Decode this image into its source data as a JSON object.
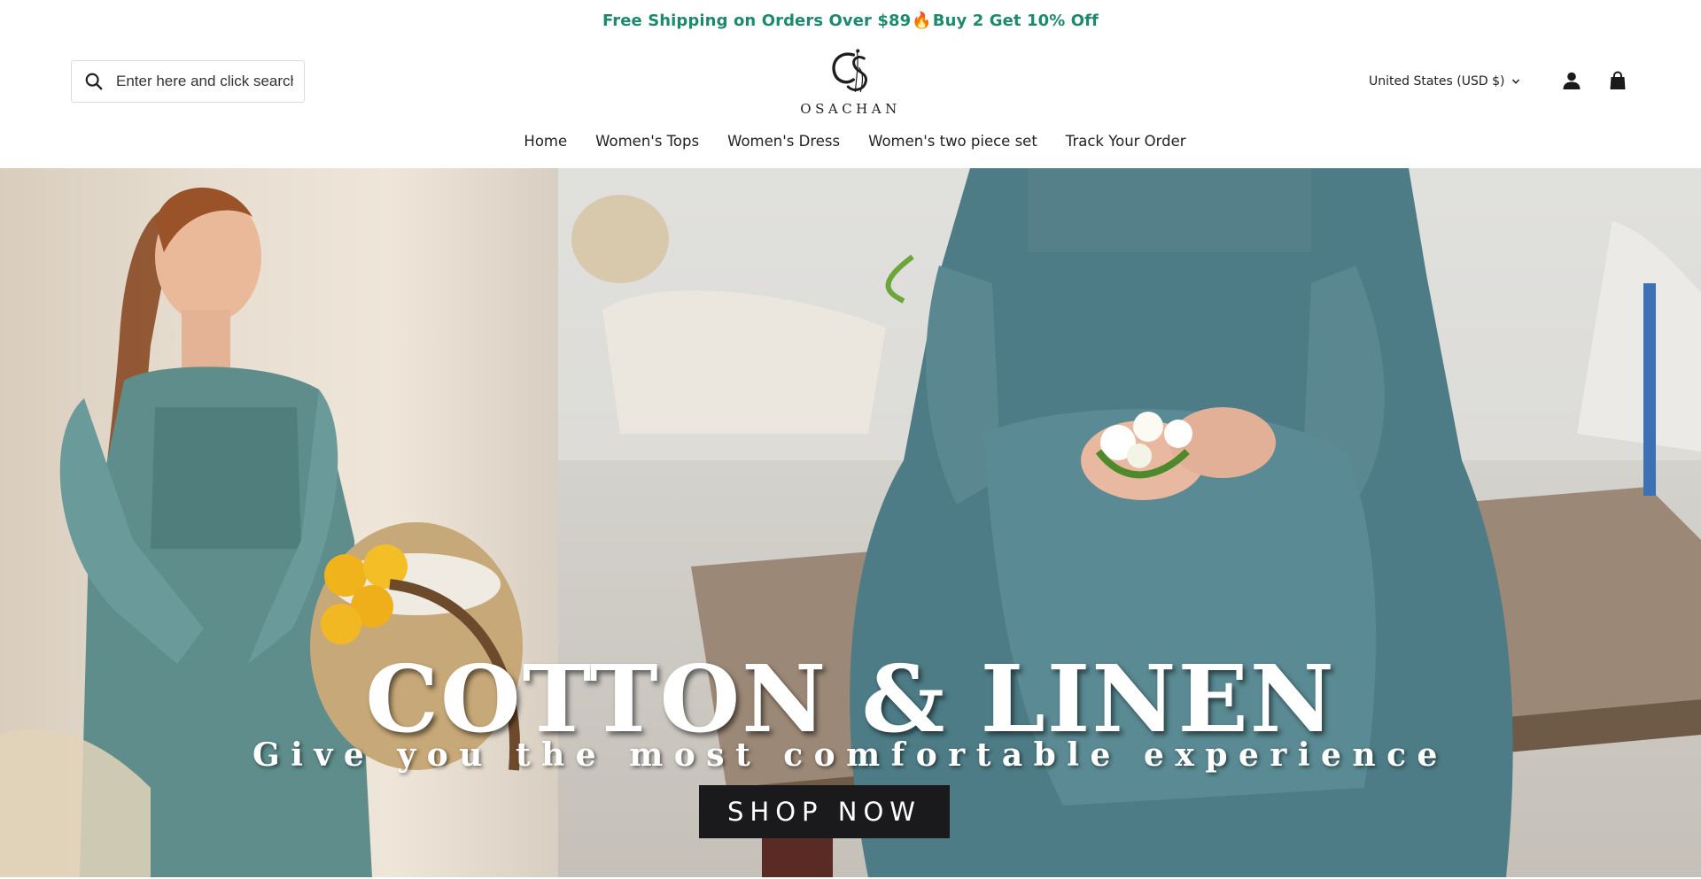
{
  "announcement": {
    "text_before": "Free Shipping on Orders Over $89 ",
    "flame": "🔥",
    "text_after": "Buy 2 Get 10% Off",
    "color": "#1d8a6e"
  },
  "search": {
    "placeholder": "Enter here and click search",
    "icon": "search-icon"
  },
  "logo": {
    "wordmark": "OSACHAN"
  },
  "currency": {
    "label": "United States (USD $)",
    "icon": "chevron-down-icon"
  },
  "header_icons": {
    "account": "account-icon",
    "cart": "cart-icon"
  },
  "nav": {
    "items": [
      {
        "label": "Home"
      },
      {
        "label": "Women's Tops"
      },
      {
        "label": "Women's Dress"
      },
      {
        "label": "Women's two piece set"
      },
      {
        "label": "Track Your Order"
      }
    ]
  },
  "hero": {
    "title": "COTTON & LINEN",
    "subtitle": "Give you the most comfortable experience",
    "cta_label": "SHOP NOW"
  }
}
